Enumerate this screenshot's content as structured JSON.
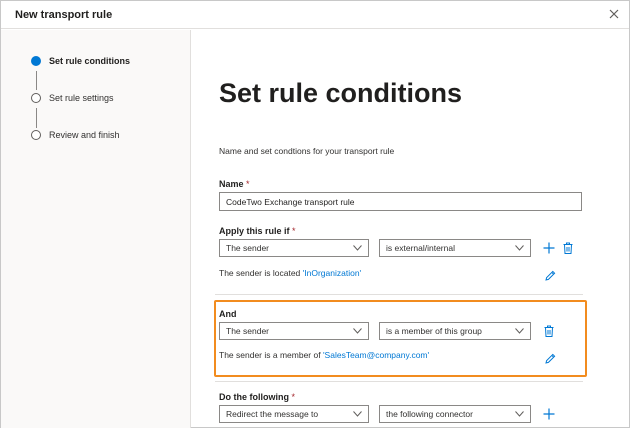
{
  "window": {
    "title": "New transport rule"
  },
  "steps": [
    {
      "label": "Set rule conditions",
      "active": true
    },
    {
      "label": "Set rule settings",
      "active": false
    },
    {
      "label": "Review and finish",
      "active": false
    }
  ],
  "main": {
    "title": "Set rule conditions",
    "subtitle": "Name and set condtions for your transport rule",
    "name": {
      "label": "Name",
      "required": "*",
      "value": "CodeTwo Exchange transport rule"
    },
    "apply": {
      "label": "Apply this rule if",
      "required": "*",
      "condition1": "The sender",
      "condition2": "is external/internal",
      "desc_prefix": "The sender is located ",
      "desc_link": "'InOrganization'"
    },
    "and": {
      "label": "And",
      "condition1": "The sender",
      "condition2": "is a member of this group",
      "desc_prefix": "The sender is a member of ",
      "desc_link": "'SalesTeam@company.com'"
    },
    "do": {
      "label": "Do the following",
      "required": "*",
      "action1": "Redirect the message to",
      "action2": "the following connector"
    }
  },
  "colors": {
    "accent": "#0078d4",
    "highlight": "#f28c1f",
    "required": "#a4262c"
  },
  "icons": {
    "close": "close-icon",
    "add": "add-icon",
    "delete": "delete-icon",
    "edit": "edit-icon",
    "chevron": "chevron-down-icon"
  }
}
